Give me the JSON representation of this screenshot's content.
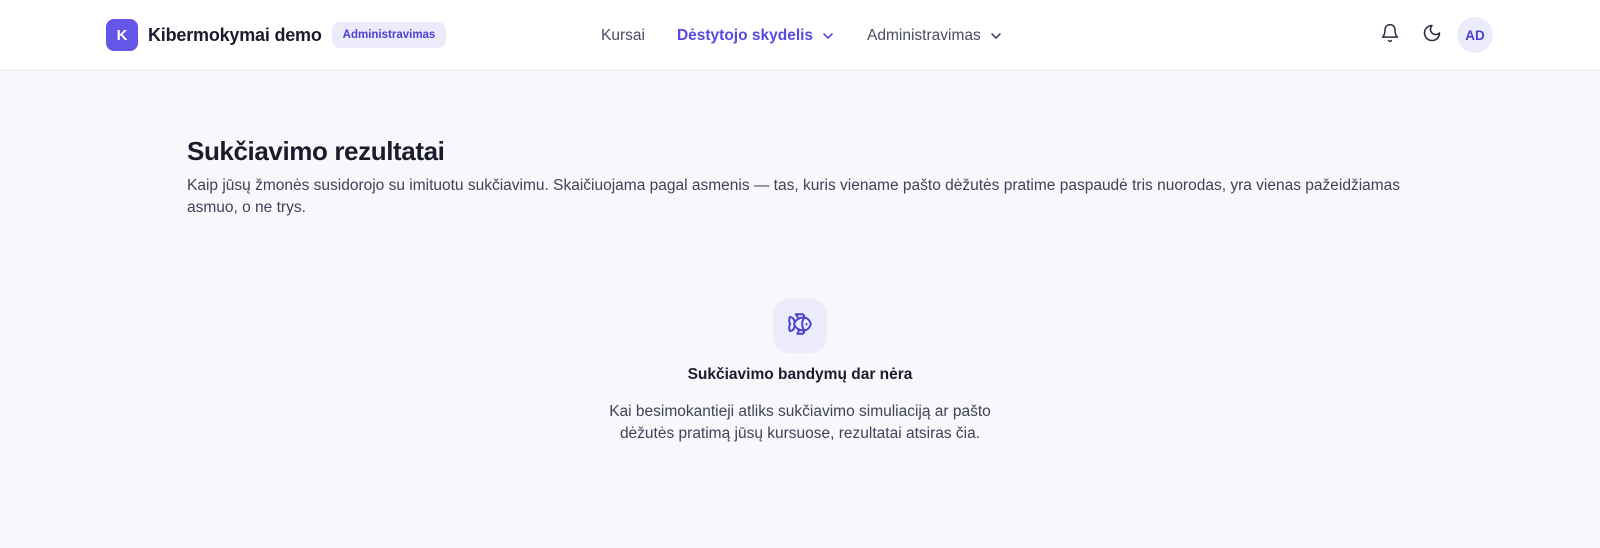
{
  "brand": {
    "logo_letter": "K",
    "name": "Kibermokymai demo",
    "role_badge": "Administravimas"
  },
  "nav": {
    "items": [
      {
        "label": "Kursai",
        "active": false,
        "has_dropdown": false
      },
      {
        "label": "Dėstytojo skydelis",
        "active": true,
        "has_dropdown": true
      },
      {
        "label": "Administravimas",
        "active": false,
        "has_dropdown": true
      }
    ]
  },
  "actions": {
    "notifications_icon": "bell-icon",
    "theme_icon": "moon-icon",
    "avatar_initials": "AD"
  },
  "page": {
    "title": "Sukčiavimo rezultatai",
    "description": "Kaip jūsų žmonės susidorojo su imituotu sukčiavimu. Skaičiuojama pagal asmenis — tas, kuris viename pašto dėžutės pratime paspaudė tris nuorodas, yra vienas pažeidžiamas asmuo, o ne trys."
  },
  "empty_state": {
    "icon": "fish-icon",
    "title": "Sukčiavimo bandymų dar nėra",
    "description": "Kai besimokantieji atliks sukčiavimo simuliaciją ar pašto dėžutės pratimą jūsų kursuose, rezultatai atsiras čia."
  },
  "colors": {
    "accent": "#5a49e0",
    "accent_soft": "#ecebfb",
    "background": "#f8f8fc",
    "surface": "#ffffff"
  }
}
